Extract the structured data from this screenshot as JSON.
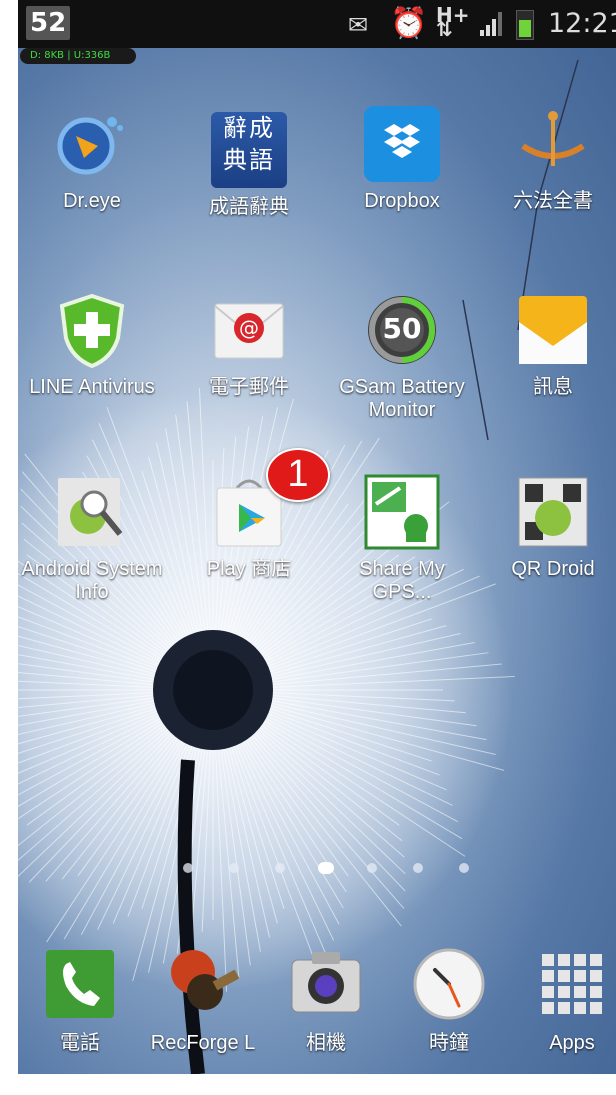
{
  "status_bar": {
    "battery_level": "52",
    "time": "12:21",
    "traffic": "D: 8KB | U:336B"
  },
  "home_grid": [
    {
      "label": "Dr.eye",
      "icon": "dreye-icon"
    },
    {
      "label": "成語辭典",
      "icon": "idiom-dictionary-icon",
      "icon_text": "辭成典語"
    },
    {
      "label": "Dropbox",
      "icon": "dropbox-icon"
    },
    {
      "label": "六法全書",
      "icon": "law-book-icon"
    },
    {
      "label": "LINE Antivirus",
      "icon": "line-antivirus-icon"
    },
    {
      "label": "電子郵件",
      "icon": "email-icon"
    },
    {
      "label": "GSam Battery Monitor",
      "icon": "gsam-battery-icon",
      "icon_text": "50"
    },
    {
      "label": "訊息",
      "icon": "messages-icon"
    },
    {
      "label": "Android System Info",
      "icon": "android-system-info-icon"
    },
    {
      "label": "Play 商店",
      "icon": "play-store-icon"
    },
    {
      "label": "Share My GPS...",
      "icon": "share-my-gps-icon"
    },
    {
      "label": "QR Droid",
      "icon": "qr-droid-icon"
    }
  ],
  "marker": {
    "number": "1",
    "color": "#e01919"
  },
  "page_indicator": {
    "pages": 7,
    "current": 4
  },
  "dock": [
    {
      "label": "電話",
      "icon": "phone-icon"
    },
    {
      "label": "RecForge L",
      "icon": "recforge-icon"
    },
    {
      "label": "相機",
      "icon": "camera-icon"
    },
    {
      "label": "時鐘",
      "icon": "clock-icon"
    },
    {
      "label": "Apps",
      "icon": "apps-grid-icon"
    }
  ]
}
